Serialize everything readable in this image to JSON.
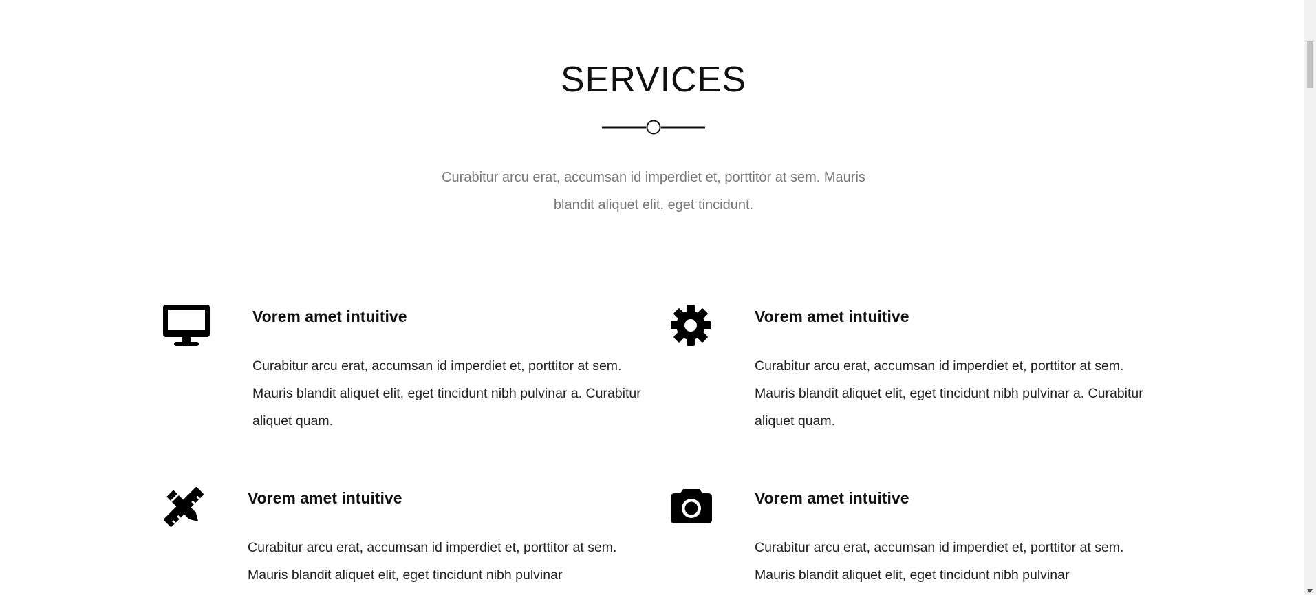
{
  "section": {
    "title": "SERVICES",
    "intro": "Curabitur arcu erat, accumsan id imperdiet et, porttitor at sem. Mauris blandit aliquet elit, eget tincidunt."
  },
  "services": [
    {
      "icon": "desktop-icon",
      "title": "Vorem amet intuitive",
      "text": "Curabitur arcu erat, accumsan id imperdiet et, porttitor at sem. Mauris blandit aliquet elit, eget tincidunt nibh pulvinar a. Curabitur aliquet quam."
    },
    {
      "icon": "gear-icon",
      "title": "Vorem amet intuitive",
      "text": "Curabitur arcu erat, accumsan id imperdiet et, porttitor at sem. Mauris blandit aliquet elit, eget tincidunt nibh pulvinar a. Curabitur aliquet quam."
    },
    {
      "icon": "pencil-ruler-icon",
      "title": "Vorem amet intuitive",
      "text": "Curabitur arcu erat, accumsan id imperdiet et, porttitor at sem. Mauris blandit aliquet elit, eget tincidunt nibh pulvinar"
    },
    {
      "icon": "camera-icon",
      "title": "Vorem amet intuitive",
      "text": "Curabitur arcu erat, accumsan id imperdiet et, porttitor at sem. Mauris blandit aliquet elit, eget tincidunt nibh pulvinar"
    }
  ],
  "colors": {
    "text": "#111111",
    "muted": "#777777",
    "background": "#ffffff"
  }
}
